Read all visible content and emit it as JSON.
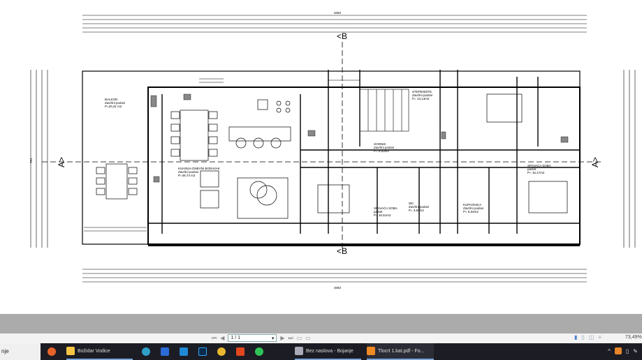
{
  "plan": {
    "section_marks": {
      "b_top": "B",
      "b_bottom": "B",
      "a_left": "A",
      "a_right": "A"
    },
    "rooms": [
      {
        "name": "BALKON",
        "sub": "Završni podovi",
        "area": "P=20,31 m2"
      },
      {
        "name": "KUHINJA DNEVNI BORAVAK",
        "sub": "Završni podovi",
        "area": "P=49,74 m2"
      },
      {
        "name": "STEPENIŠTE",
        "sub": "Završni podovi",
        "area": "P= 13,14m2"
      },
      {
        "name": "HODNIK",
        "sub": "Završni podovi",
        "area": "P= 9,93m2"
      },
      {
        "name": "SPAVAĆA SOBA",
        "sub": "parket",
        "area": "P= 16,17m2"
      },
      {
        "name": "SPAVAĆA SOBA",
        "sub": "parket",
        "area": "P= 16,51m2"
      },
      {
        "name": "KUPAONICA",
        "sub": "Završni podovi",
        "area": "P= 5,04m2"
      },
      {
        "name": "WC",
        "sub": "Završni podovi",
        "area": "P= 3,59m2"
      }
    ],
    "dims": {
      "top_total": "2083",
      "bottom_total": "2083",
      "side_total": "781"
    }
  },
  "viewer": {
    "page": "1 / 1",
    "zoom": "73,49%"
  },
  "taskbar": {
    "left_stub": "nje",
    "folder": "Božidar Vodice",
    "paint": "Bez naslova - Bojanje",
    "pdf": "Tlocrt 1.kat.pdf - Fo..."
  },
  "colors": {
    "taskbar": "#1c1c24",
    "gray_band": "#ababab"
  }
}
